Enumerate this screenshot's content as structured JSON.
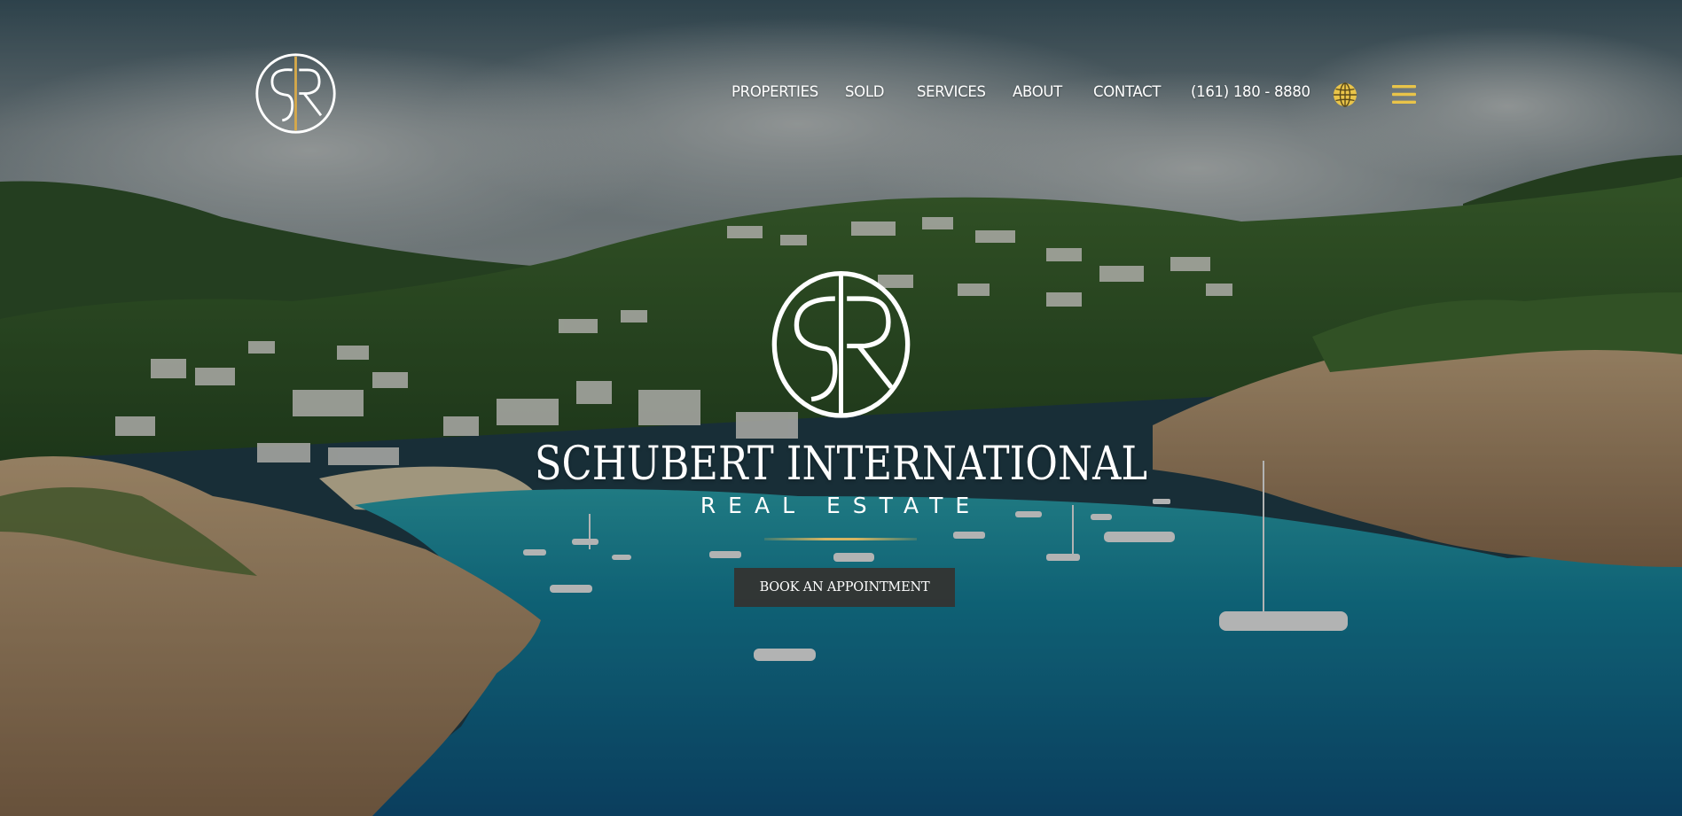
{
  "header": {
    "logo_name": "SR monogram logo",
    "nav": [
      {
        "label": "PROPERTIES"
      },
      {
        "label": "SOLD"
      },
      {
        "label": "SERVICES"
      },
      {
        "label": "ABOUT"
      },
      {
        "label": "CONTACT"
      },
      {
        "label": "(161) 180 - 8880"
      }
    ],
    "globe_icon": "globe-icon",
    "menu_icon": "hamburger-menu-icon"
  },
  "hero": {
    "title": "SCHUBERT INTERNATIONAL",
    "subtitle": "REAL ESTATE",
    "cta_label": "BOOK AN APPOINTMENT"
  },
  "colors": {
    "accent_gold": "#e9c449",
    "line_gold": "#d6b563",
    "button_bg": "#343230",
    "text": "#ffffff"
  }
}
